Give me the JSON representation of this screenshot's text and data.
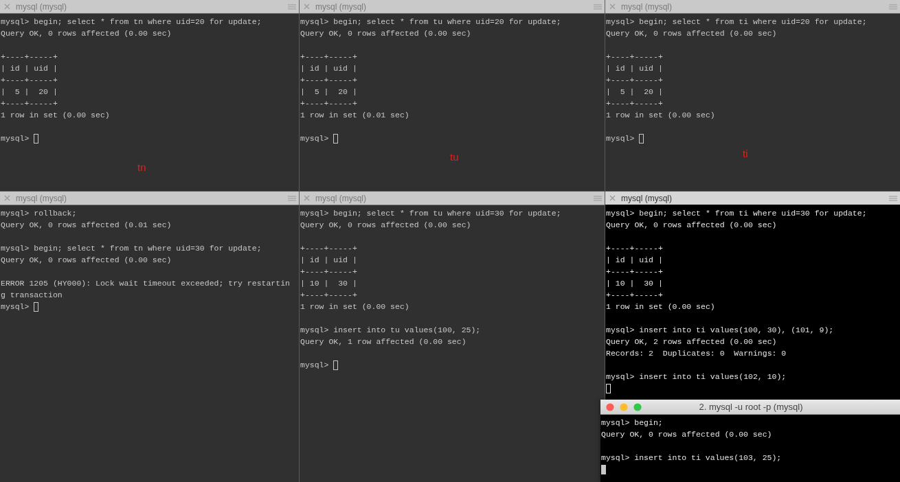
{
  "panes": [
    {
      "title": "mysql (mysql)",
      "active": false,
      "annotation": "tn",
      "cursor": {
        "kind": "hollow",
        "own_line": false
      },
      "blocks": [
        [
          "mysql> begin; select * from tn where uid=20 for update;",
          "Query OK, 0 rows affected (0.00 sec)"
        ],
        [
          "+----+-----+",
          "| id | uid |",
          "+----+-----+",
          "|  5 |  20 |",
          "+----+-----+",
          "1 row in set (0.00 sec)"
        ],
        [
          "mysql>"
        ]
      ]
    },
    {
      "title": "mysql (mysql)",
      "active": false,
      "annotation": "tu",
      "cursor": {
        "kind": "hollow",
        "own_line": false
      },
      "blocks": [
        [
          "mysql> begin; select * from tu where uid=20 for update;",
          "Query OK, 0 rows affected (0.00 sec)"
        ],
        [
          "+----+-----+",
          "| id | uid |",
          "+----+-----+",
          "|  5 |  20 |",
          "+----+-----+",
          "1 row in set (0.01 sec)"
        ],
        [
          "mysql>"
        ]
      ]
    },
    {
      "title": "mysql (mysql)",
      "active": false,
      "annotation": "ti",
      "cursor": {
        "kind": "hollow",
        "own_line": false
      },
      "blocks": [
        [
          "mysql> begin; select * from ti where uid=20 for update;",
          "Query OK, 0 rows affected (0.00 sec)"
        ],
        [
          "+----+-----+",
          "| id | uid |",
          "+----+-----+",
          "|  5 |  20 |",
          "+----+-----+",
          "1 row in set (0.00 sec)"
        ],
        [
          "mysql>"
        ]
      ]
    },
    {
      "title": "mysql (mysql)",
      "active": false,
      "cursor": {
        "kind": "hollow",
        "own_line": false
      },
      "blocks": [
        [
          "mysql> rollback;",
          "Query OK, 0 rows affected (0.01 sec)"
        ],
        [
          "mysql> begin; select * from tn where uid=30 for update;",
          "Query OK, 0 rows affected (0.00 sec)"
        ],
        [
          "ERROR 1205 (HY000): Lock wait timeout exceeded; try restartin",
          "g transaction",
          "mysql>"
        ]
      ]
    },
    {
      "title": "mysql (mysql)",
      "active": false,
      "cursor": {
        "kind": "hollow",
        "own_line": false
      },
      "blocks": [
        [
          "mysql> begin; select * from tu where uid=30 for update;",
          "Query OK, 0 rows affected (0.00 sec)"
        ],
        [
          "+----+-----+",
          "| id | uid |",
          "+----+-----+",
          "| 10 |  30 |",
          "+----+-----+",
          "1 row in set (0.00 sec)"
        ],
        [
          "mysql> insert into tu values(100, 25);",
          "Query OK, 1 row affected (0.00 sec)"
        ],
        [
          "mysql>"
        ]
      ]
    },
    {
      "title": "mysql (mysql)",
      "active": true,
      "cursor": {
        "kind": "hollow",
        "own_line": true
      },
      "blocks": [
        [
          "mysql> begin; select * from ti where uid=30 for update;",
          "Query OK, 0 rows affected (0.00 sec)"
        ],
        [
          "+----+-----+",
          "| id | uid |",
          "+----+-----+",
          "| 10 |  30 |",
          "+----+-----+",
          "1 row in set (0.00 sec)"
        ],
        [
          "mysql> insert into ti values(100, 30), (101, 9);",
          "Query OK, 2 rows affected (0.00 sec)",
          "Records: 2  Duplicates: 0  Warnings: 0"
        ],
        [
          "mysql> insert into ti values(102, 10);"
        ]
      ]
    }
  ],
  "floating_window": {
    "title": "2. mysql -u root -p (mysql)",
    "active": true,
    "cursor": {
      "kind": "filled",
      "own_line": true
    },
    "blocks": [
      [
        "mysql> begin;",
        "Query OK, 0 rows affected (0.00 sec)"
      ],
      [
        "mysql> insert into ti values(103, 25);"
      ]
    ]
  }
}
